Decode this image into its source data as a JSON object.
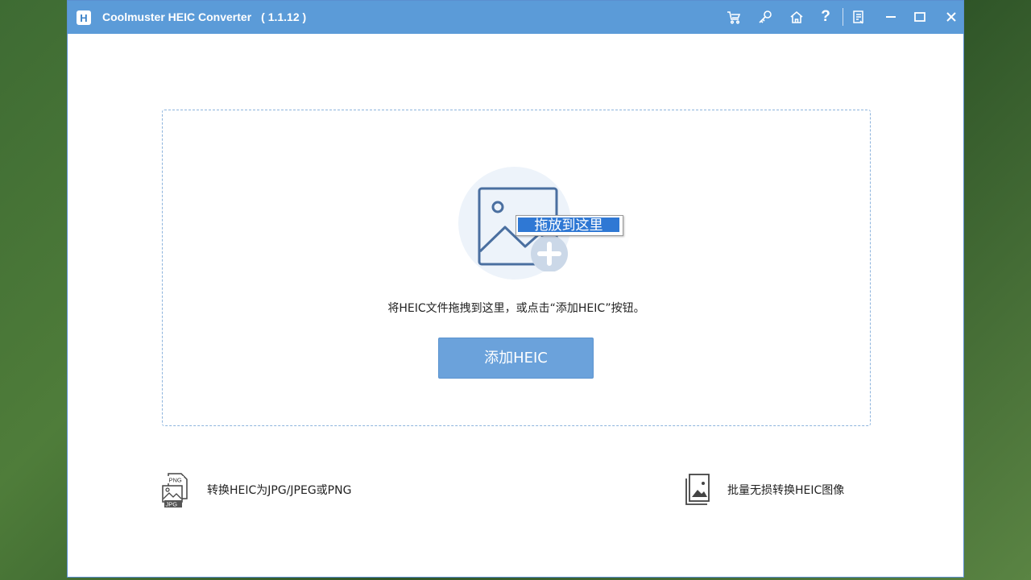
{
  "window": {
    "app_name": "Coolmuster HEIC Converter",
    "version": "( 1.1.12 )",
    "logo_letter": "H",
    "accent_color": "#5b9bd8",
    "toolbar_icons": [
      "cart-icon",
      "key-icon",
      "home-icon",
      "help-icon",
      "feedback-icon",
      "minimize-icon",
      "maximize-icon",
      "close-icon"
    ],
    "help_glyph": "?"
  },
  "dropzone": {
    "tooltip": "拖放到这里",
    "hint": "将HEIC文件拖拽到这里，或点击“添加HEIC”按钮。",
    "add_button": "添加HEIC"
  },
  "features": [
    {
      "label": "转换HEIC为JPG/JPEG或PNG",
      "icon": "png-jpg-convert-icon",
      "badge_top": "PNG",
      "badge_bottom": "JPG"
    },
    {
      "label": "批量无损转换HEIC图像",
      "icon": "image-stack-icon"
    }
  ]
}
